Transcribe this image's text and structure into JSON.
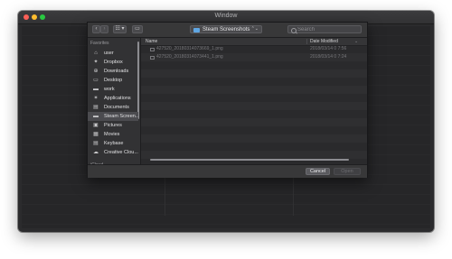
{
  "window": {
    "title": "Window"
  },
  "toolbar": {
    "back_label": "‹",
    "forward_label": "›",
    "view_label": "☷ ▾",
    "view_menu_label": "",
    "new_folder_label": "▭",
    "path_popup_label": "Steam Screenshots",
    "path_popup_arrows": "⌃⌄",
    "search_placeholder": "Search"
  },
  "sidebar": {
    "favorites_heading": "Favorites",
    "items": [
      {
        "label": "user",
        "icon": "home-icon",
        "glyph": "⌂"
      },
      {
        "label": "Dropbox",
        "icon": "dropbox-icon",
        "glyph": "✦"
      },
      {
        "label": "Downloads",
        "icon": "downloads-icon",
        "glyph": "⊕"
      },
      {
        "label": "Desktop",
        "icon": "desktop-icon",
        "glyph": "▭"
      },
      {
        "label": "work",
        "icon": "folder-icon",
        "glyph": "▬"
      },
      {
        "label": "Applications",
        "icon": "applications-icon",
        "glyph": "✶"
      },
      {
        "label": "Documents",
        "icon": "documents-icon",
        "glyph": "▤"
      },
      {
        "label": "Steam Screen...",
        "icon": "folder-icon",
        "glyph": "▬"
      },
      {
        "label": "Pictures",
        "icon": "pictures-icon",
        "glyph": "▣"
      },
      {
        "label": "Movies",
        "icon": "movies-icon",
        "glyph": "▦"
      },
      {
        "label": "Keybase",
        "icon": "keybase-icon",
        "glyph": "▤"
      },
      {
        "label": "Creative Clou...",
        "icon": "creative-cloud-icon",
        "glyph": "☁"
      }
    ],
    "selected_index": 7,
    "icloud_heading": "iCloud"
  },
  "file_list": {
    "columns": {
      "name": "Name",
      "date": "Date Modified",
      "sort_indicator": "⌄"
    },
    "files": [
      {
        "name": "427520_20180314073669_1.png",
        "date": "2018/03/14 0 7:56"
      },
      {
        "name": "427520_20180314073441_1.png",
        "date": "2018/03/14 0 7:24"
      }
    ]
  },
  "footer": {
    "cancel_label": "Cancel",
    "open_label": "Open"
  },
  "colors": {
    "window_bg": "#2b2b2d",
    "accent_folder": "#5fa6e3",
    "close": "#fc5f57",
    "minimize": "#fdbc2e",
    "maximize": "#29c841"
  }
}
